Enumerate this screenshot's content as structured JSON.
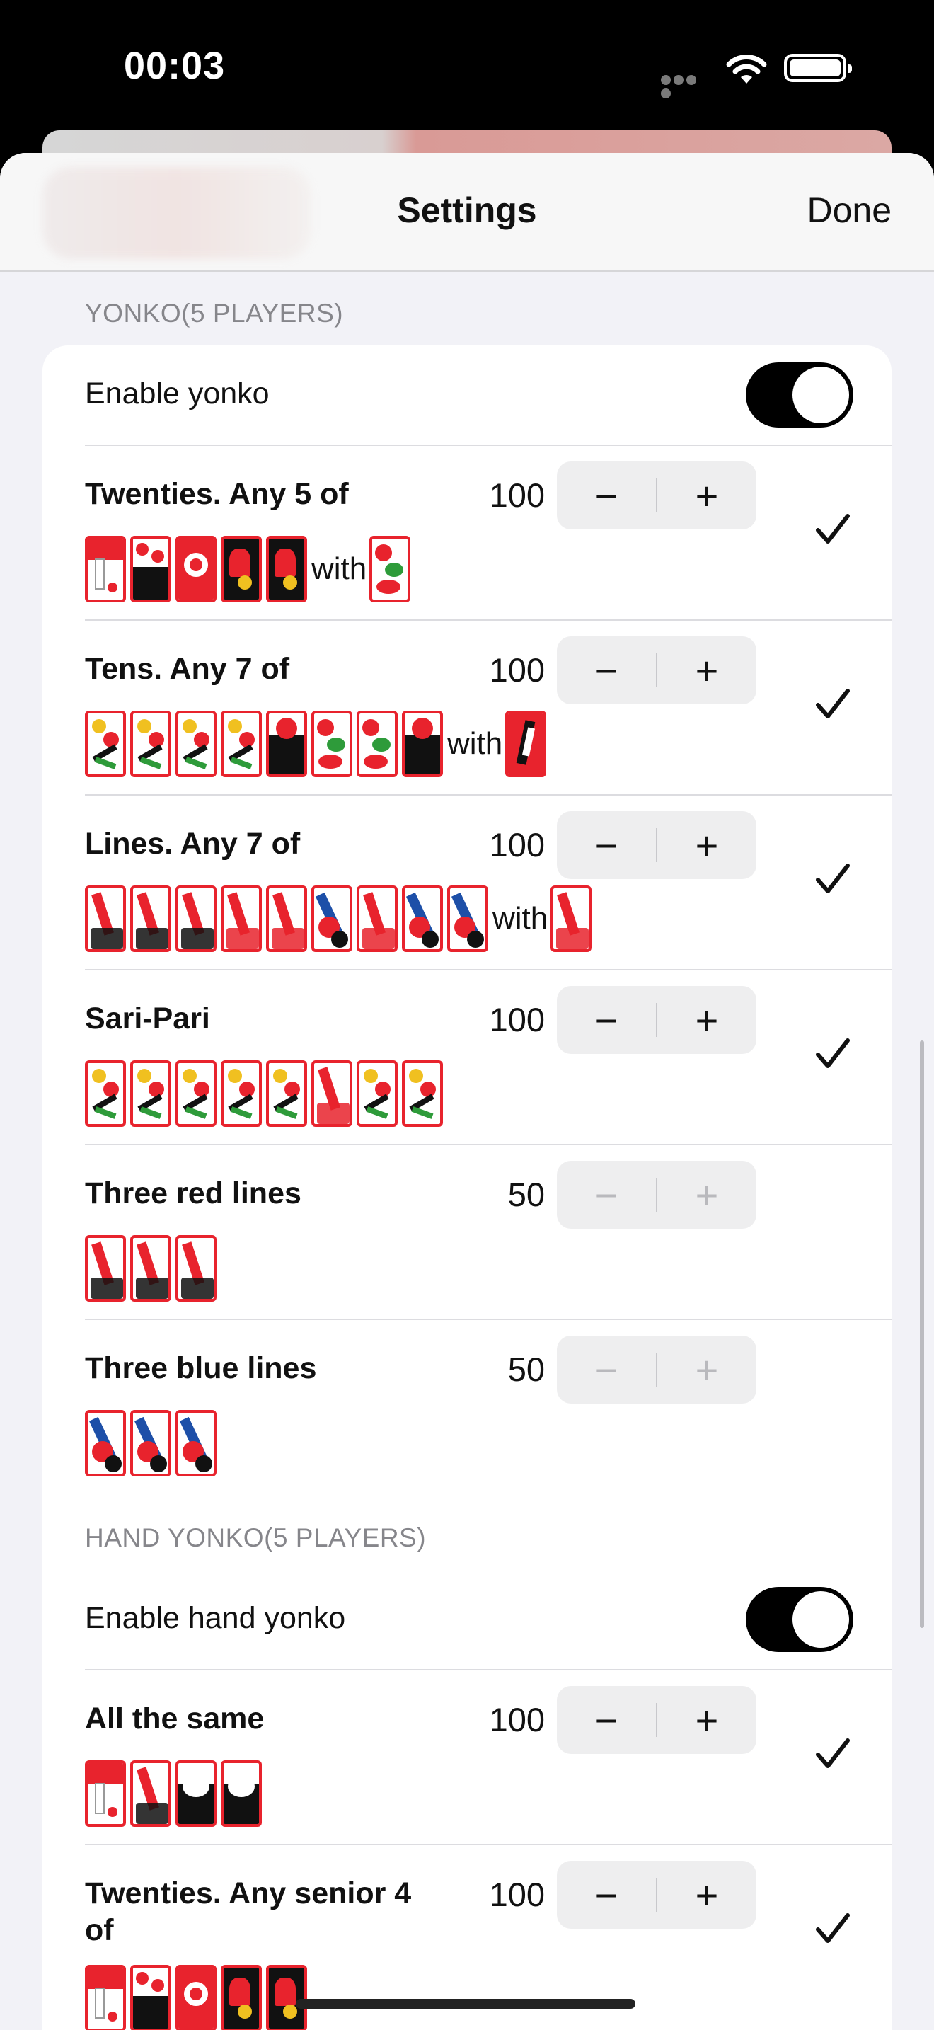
{
  "status_bar": {
    "time": "00:03"
  },
  "nav": {
    "title": "Settings",
    "done_label": "Done"
  },
  "yonko": {
    "header": "YONKO(5 PLAYERS)",
    "toggle_label": "Enable yonko",
    "rows": [
      {
        "title": "Twenties. Any 5 of",
        "value": "100",
        "checked": true,
        "cards": [
          "crane",
          "curtain",
          "moon",
          "phoenix",
          "rain-man"
        ],
        "with": "with",
        "with_card": [
          "bush-warbler"
        ]
      },
      {
        "title": "Tens. Any 7 of",
        "value": "100",
        "checked": true,
        "cards": [
          "iris-bridge",
          "deer",
          "geese",
          "butterflies",
          "boar",
          "cuckoo",
          "bush-warbler",
          "sake-cup"
        ],
        "with": "with",
        "with_card": [
          "swallow"
        ]
      },
      {
        "title": "Lines. Any 7 of",
        "value": "100",
        "checked": true,
        "cards": [
          "red-poem",
          "red-poem-plum",
          "red-poem-cherry",
          "red-wisteria",
          "red-iris",
          "blue-peony",
          "red-clover",
          "blue-chrys",
          "blue-maple"
        ],
        "with": "with",
        "with_card": [
          "red-willow"
        ]
      },
      {
        "title": "Sari-Pari",
        "value": "100",
        "checked": true,
        "cards": [
          "geese",
          "wisteria",
          "pine",
          "pine2",
          "deer",
          "red-ribbon",
          "clover",
          "maple"
        ]
      },
      {
        "title": "Three red lines",
        "value": "50",
        "checked": false,
        "cards": [
          "red-poem",
          "red-poem-plum",
          "red-poem-cherry"
        ]
      },
      {
        "title": "Three blue lines",
        "value": "50",
        "checked": false,
        "cards": [
          "blue-peony",
          "blue-chrys",
          "blue-maple"
        ]
      }
    ]
  },
  "hand_yonko": {
    "header": "HAND YONKO(5 PLAYERS)",
    "toggle_label": "Enable hand yonko",
    "rows": [
      {
        "title": "All the same",
        "value": "100",
        "checked": true,
        "cards": [
          "crane",
          "red-poem",
          "pine-plain",
          "pine-plain2"
        ]
      },
      {
        "title": "Twenties. Any senior 4 of",
        "value": "100",
        "checked": true,
        "cards": [
          "crane",
          "curtain",
          "moon",
          "phoenix",
          "rain-man"
        ]
      }
    ]
  },
  "icons": [
    "wifi-icon",
    "battery-icon",
    "minus-icon",
    "plus-icon",
    "checkmark-icon"
  ],
  "colors": {
    "card_border": "#e8232d",
    "switch_on": "#000000",
    "background": "#f2f2f7"
  }
}
